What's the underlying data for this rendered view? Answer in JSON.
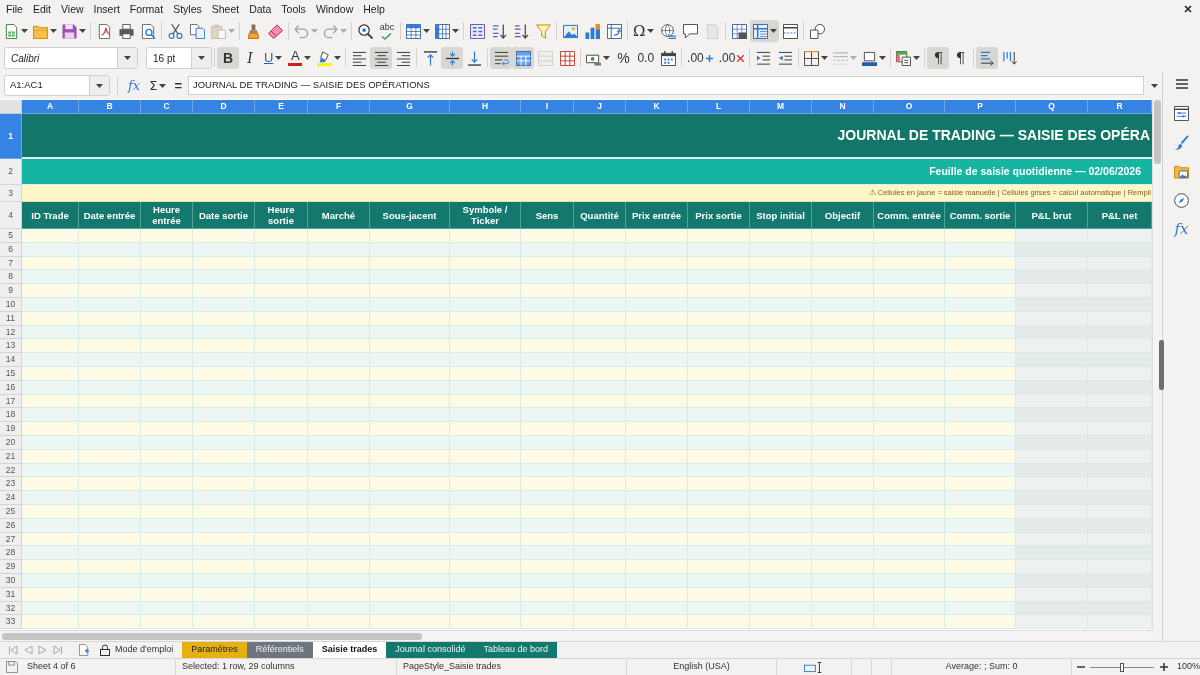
{
  "menu_bar": [
    "File",
    "Edit",
    "View",
    "Insert",
    "Format",
    "Styles",
    "Sheet",
    "Data",
    "Tools",
    "Window",
    "Help"
  ],
  "standard_toolbar": [
    {
      "kind": "new",
      "on": false,
      "disabled": false
    },
    {
      "kind": "open",
      "on": false,
      "disabled": false
    },
    {
      "kind": "save",
      "on": false,
      "disabled": false
    },
    {
      "kind": "export_pdf",
      "on": false,
      "disabled": false
    },
    {
      "kind": "print",
      "on": false,
      "disabled": false
    },
    {
      "kind": "print_preview",
      "on": false,
      "disabled": false
    },
    {
      "kind": "cut",
      "on": false,
      "disabled": false
    },
    {
      "kind": "copy",
      "on": false,
      "disabled": false
    },
    {
      "kind": "paste",
      "on": false,
      "disabled": true
    },
    {
      "kind": "clone_formatting",
      "on": false,
      "disabled": false
    },
    {
      "kind": "clear_formatting",
      "on": false,
      "disabled": false
    },
    {
      "kind": "undo",
      "on": false,
      "disabled": true
    },
    {
      "kind": "redo",
      "on": false,
      "disabled": true
    },
    {
      "kind": "find_replace",
      "on": false,
      "disabled": false
    },
    {
      "kind": "spelling",
      "glyph": "abc",
      "on": false,
      "disabled": false
    },
    {
      "kind": "rows",
      "on": false,
      "disabled": false
    },
    {
      "kind": "columns",
      "on": false,
      "disabled": false
    },
    {
      "kind": "sort",
      "on": false,
      "disabled": false
    },
    {
      "kind": "sort_ascending",
      "on": false,
      "disabled": false
    },
    {
      "kind": "sort_descending",
      "on": false,
      "disabled": false
    },
    {
      "kind": "autofilter",
      "on": false,
      "disabled": false
    },
    {
      "kind": "image",
      "on": false,
      "disabled": false
    },
    {
      "kind": "chart",
      "on": false,
      "disabled": false
    },
    {
      "kind": "pivot_table",
      "on": false,
      "disabled": false
    },
    {
      "kind": "special_character",
      "glyph": "Ω",
      "on": false,
      "disabled": false
    },
    {
      "kind": "hyperlink",
      "on": false,
      "disabled": false
    },
    {
      "kind": "comment",
      "on": false,
      "disabled": false
    },
    {
      "kind": "headers_footers",
      "on": false,
      "disabled": true
    },
    {
      "kind": "print_area",
      "on": false,
      "disabled": false
    },
    {
      "kind": "freeze",
      "on": true,
      "disabled": false
    },
    {
      "kind": "split_window",
      "on": false,
      "disabled": false
    },
    {
      "kind": "shapes",
      "on": false,
      "disabled": false
    }
  ],
  "formatting_toolbar": {
    "font_name": "Calibri",
    "font_size": "16 pt",
    "buttons": [
      {
        "kind": "bold",
        "glyph": "B",
        "on": true,
        "disabled": false
      },
      {
        "kind": "italic",
        "glyph": "I",
        "on": false,
        "disabled": false
      },
      {
        "kind": "underline",
        "glyph": "U",
        "on": false,
        "disabled": false
      },
      {
        "kind": "font_color",
        "glyph": "A",
        "on": false,
        "disabled": false
      },
      {
        "kind": "highlight",
        "on": false,
        "disabled": false
      },
      {
        "kind": "align_left",
        "on": false,
        "disabled": false
      },
      {
        "kind": "align_center",
        "on": true,
        "disabled": false
      },
      {
        "kind": "align_right",
        "on": false,
        "disabled": false
      },
      {
        "kind": "align_top",
        "on": false,
        "disabled": false
      },
      {
        "kind": "align_middle",
        "on": true,
        "disabled": false
      },
      {
        "kind": "align_bottom",
        "on": false,
        "disabled": false
      },
      {
        "kind": "wrap_text",
        "on": true,
        "disabled": false
      },
      {
        "kind": "merge_center",
        "on": true,
        "disabled": false
      },
      {
        "kind": "merge_cells",
        "on": false,
        "disabled": true
      },
      {
        "kind": "unmerge_cells",
        "on": false,
        "disabled": false
      },
      {
        "kind": "currency",
        "on": false,
        "disabled": false
      },
      {
        "kind": "percent",
        "glyph": "%",
        "on": false,
        "disabled": false
      },
      {
        "kind": "number",
        "glyph": "0.0",
        "on": false,
        "disabled": false
      },
      {
        "kind": "date",
        "on": false,
        "disabled": false
      },
      {
        "kind": "add_decimal",
        "glyph": ".00",
        "on": false,
        "disabled": false
      },
      {
        "kind": "delete_decimal",
        "glyph": ".00",
        "on": false,
        "disabled": false
      },
      {
        "kind": "indent_increase",
        "on": false,
        "disabled": false
      },
      {
        "kind": "indent_decrease",
        "on": false,
        "disabled": false
      },
      {
        "kind": "borders",
        "on": false,
        "disabled": false
      },
      {
        "kind": "border_style",
        "on": false,
        "disabled": true
      },
      {
        "kind": "border_color",
        "on": false,
        "disabled": false
      },
      {
        "kind": "conditional",
        "on": false,
        "disabled": false
      },
      {
        "kind": "paragraph_ltr",
        "glyph": "¶",
        "on": true,
        "disabled": false
      },
      {
        "kind": "paragraph_rtl",
        "glyph": "¶",
        "on": false,
        "disabled": false
      },
      {
        "kind": "text_horizontal",
        "on": true,
        "disabled": false
      },
      {
        "kind": "text_vertical",
        "on": false,
        "disabled": false
      }
    ]
  },
  "formula_bar": {
    "name_box": "A1:AC1",
    "function_wizard": "fx",
    "sum": "Σ",
    "equals": "=",
    "content": "JOURNAL DE TRADING — SAISIE DES OPÉRATIONS"
  },
  "sheet": {
    "columns": [
      {
        "letter": "A",
        "header": "ID Trade",
        "kind": "input",
        "selected": true
      },
      {
        "letter": "B",
        "header": "Date entrée",
        "kind": "input",
        "selected": true
      },
      {
        "letter": "C",
        "header": "Heure entrée",
        "kind": "input",
        "selected": true
      },
      {
        "letter": "D",
        "header": "Date sortie",
        "kind": "input",
        "selected": true
      },
      {
        "letter": "E",
        "header": "Heure sortie",
        "kind": "input",
        "selected": true
      },
      {
        "letter": "F",
        "header": "Marché",
        "kind": "input",
        "selected": true
      },
      {
        "letter": "G",
        "header": "Sous-jacent",
        "kind": "input",
        "selected": true
      },
      {
        "letter": "H",
        "header": "Symbole / Ticker",
        "kind": "input",
        "selected": true
      },
      {
        "letter": "I",
        "header": "Sens",
        "kind": "input",
        "selected": true
      },
      {
        "letter": "J",
        "header": "Quantité",
        "kind": "input",
        "selected": true
      },
      {
        "letter": "K",
        "header": "Prix entrée",
        "kind": "input",
        "selected": true
      },
      {
        "letter": "L",
        "header": "Prix sortie",
        "kind": "input",
        "selected": true
      },
      {
        "letter": "M",
        "header": "Stop initial",
        "kind": "input",
        "selected": true
      },
      {
        "letter": "N",
        "header": "Objectif",
        "kind": "input",
        "selected": true
      },
      {
        "letter": "O",
        "header": "Comm. entrée",
        "kind": "input",
        "selected": true
      },
      {
        "letter": "P",
        "header": "Comm. sortie",
        "kind": "input",
        "selected": true
      },
      {
        "letter": "Q",
        "header": "P&L brut",
        "kind": "calculated",
        "selected": true
      },
      {
        "letter": "R",
        "header": "P&L net",
        "kind": "calculated",
        "selected": true
      }
    ],
    "rows": [
      {
        "number": "1",
        "kind": "title",
        "selected": true,
        "text": "JOURNAL DE TRADING — SAISIE DES OPÉRA"
      },
      {
        "number": "2",
        "kind": "subtitle",
        "selected": false,
        "text": "Feuille de saisie quotidienne — 02/06/2026"
      },
      {
        "number": "3",
        "kind": "note",
        "selected": false,
        "text": "⚠ Cellules en jaune = saisie manuelle | Cellules grises = calcul automatique | Rempli"
      },
      {
        "number": "4",
        "kind": "header",
        "selected": false
      },
      {
        "number": "5",
        "kind": "entry",
        "selected": false
      },
      {
        "number": "6",
        "kind": "entry",
        "selected": false
      },
      {
        "number": "7",
        "kind": "entry",
        "selected": false
      },
      {
        "number": "8",
        "kind": "entry",
        "selected": false
      },
      {
        "number": "9",
        "kind": "entry",
        "selected": false
      },
      {
        "number": "10",
        "kind": "entry",
        "selected": false
      },
      {
        "number": "11",
        "kind": "entry",
        "selected": false
      },
      {
        "number": "12",
        "kind": "entry",
        "selected": false
      },
      {
        "number": "13",
        "kind": "entry",
        "selected": false
      },
      {
        "number": "14",
        "kind": "entry",
        "selected": false
      },
      {
        "number": "15",
        "kind": "entry",
        "selected": false
      },
      {
        "number": "16",
        "kind": "entry",
        "selected": false
      },
      {
        "number": "17",
        "kind": "entry",
        "selected": false
      },
      {
        "number": "18",
        "kind": "entry",
        "selected": false
      },
      {
        "number": "19",
        "kind": "entry",
        "selected": false
      },
      {
        "number": "20",
        "kind": "entry",
        "selected": false
      },
      {
        "number": "21",
        "kind": "entry",
        "selected": false
      },
      {
        "number": "22",
        "kind": "entry",
        "selected": false
      },
      {
        "number": "23",
        "kind": "entry",
        "selected": false
      },
      {
        "number": "24",
        "kind": "entry",
        "selected": false
      },
      {
        "number": "25",
        "kind": "entry",
        "selected": false
      },
      {
        "number": "26",
        "kind": "entry",
        "selected": false
      },
      {
        "number": "27",
        "kind": "entry",
        "selected": false
      },
      {
        "number": "28",
        "kind": "entry",
        "selected": false
      },
      {
        "number": "29",
        "kind": "entry",
        "selected": false
      },
      {
        "number": "30",
        "kind": "entry",
        "selected": false
      },
      {
        "number": "31",
        "kind": "entry",
        "selected": false
      },
      {
        "number": "32",
        "kind": "entry",
        "selected": false
      },
      {
        "number": "33",
        "kind": "entry",
        "selected": false
      }
    ]
  },
  "sidebar": {
    "buttons": [
      {
        "kind": "menu"
      },
      {
        "kind": "properties"
      },
      {
        "kind": "styles"
      },
      {
        "kind": "gallery"
      },
      {
        "kind": "navigator"
      },
      {
        "kind": "functions",
        "glyph": "fx"
      }
    ]
  },
  "sheet_tabs": [
    {
      "label": "Mode d'emploi",
      "selected": false,
      "protected": true
    },
    {
      "label": "Paramètres",
      "selected": false,
      "protected": false,
      "color": "#e6b00f"
    },
    {
      "label": "Référentiels",
      "selected": false,
      "protected": false,
      "color": "#6e7480"
    },
    {
      "label": "Saisie trades",
      "selected": true,
      "protected": false
    },
    {
      "label": "Journal consolidé",
      "selected": false,
      "protected": false,
      "color": "#117a6d"
    },
    {
      "label": "Tableau de bord",
      "selected": false,
      "protected": false,
      "color": "#117a6d"
    }
  ],
  "status_bar": {
    "sheet": "Sheet 4 of 6",
    "selection": "Selected: 1 row, 29 columns",
    "page_style": "PageStyle_Saisie trades",
    "language": "English (USA)",
    "summary": "Average: ; Sum: 0",
    "zoom": {
      "level": 0.5,
      "reading": "100%"
    }
  }
}
